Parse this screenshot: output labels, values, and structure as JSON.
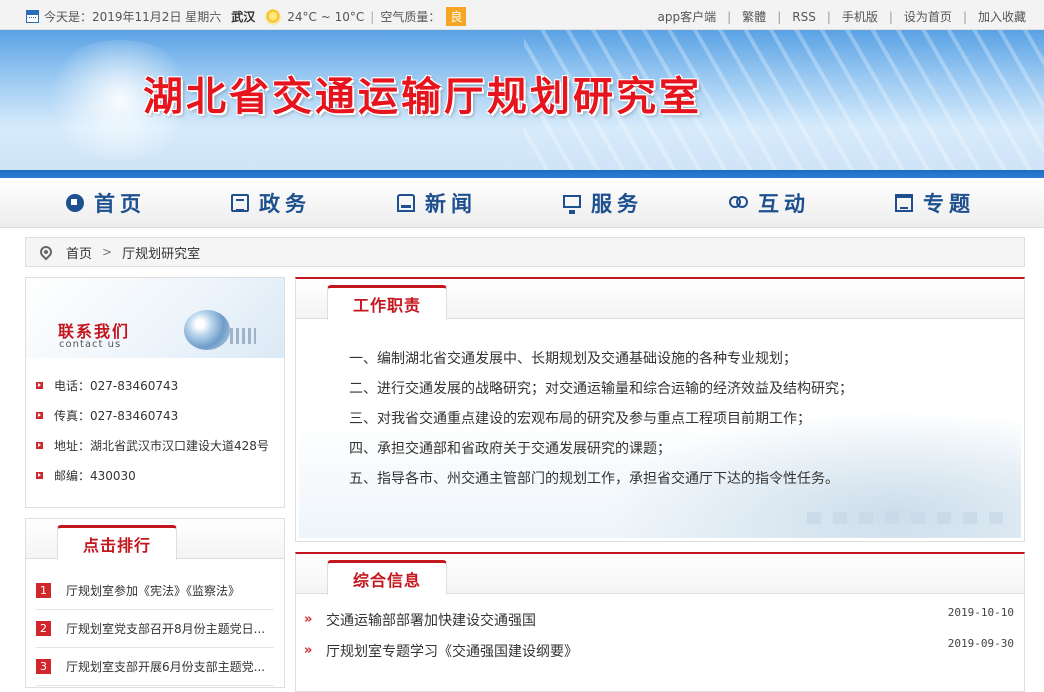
{
  "topbar": {
    "date_text": "今天是：2019年11月2日 星期六",
    "city": "武汉",
    "temperature": "24°C ~ 10°C",
    "air_quality_label": "空气质量：",
    "air_quality_value": "良",
    "air_quality_color": "#f5a623",
    "links": [
      "app客户端",
      "繁體",
      "RSS",
      "手机版",
      "设为首页",
      "加入收藏"
    ]
  },
  "banner": {
    "title": "湖北省交通运输厅规划研究室",
    "title_color": "#e6141c"
  },
  "nav": {
    "items": [
      {
        "label": "首页",
        "icon": "home-icon"
      },
      {
        "label": "政务",
        "icon": "book-icon"
      },
      {
        "label": "新闻",
        "icon": "news-icon"
      },
      {
        "label": "服务",
        "icon": "monitor-icon"
      },
      {
        "label": "互动",
        "icon": "people-icon"
      },
      {
        "label": "专题",
        "icon": "topic-icon"
      }
    ],
    "color": "#1e4f8f"
  },
  "breadcrumb": {
    "home": "首页",
    "current": "厅规划研究室"
  },
  "contact": {
    "title": "联系我们",
    "subtitle": "contact us",
    "rows": [
      "电话：027-83460743",
      "传真：027-83460743",
      "地址：湖北省武汉市汉口建设大道428号",
      "邮编：430030"
    ]
  },
  "rank": {
    "tab": "点击排行",
    "items": [
      {
        "num": "1",
        "title": "厅规划室参加《宪法》《监察法》"
      },
      {
        "num": "2",
        "title": "厅规划室党支部召开8月份主题党日..."
      },
      {
        "num": "3",
        "title": "厅规划室支部开展6月份支部主题党..."
      }
    ]
  },
  "duty": {
    "tab": "工作职责",
    "items": [
      "一、编制湖北省交通发展中、长期规划及交通基础设施的各种专业规划；",
      "二、进行交通发展的战略研究；对交通运输量和综合运输的经济效益及结构研究；",
      "三、对我省交通重点建设的宏观布局的研究及参与重点工程项目前期工作；",
      "四、承担交通部和省政府关于交通发展研究的课题；",
      "五、指导各市、州交通主管部门的规划工作，承担省交通厅下达的指令性任务。"
    ]
  },
  "info": {
    "tab": "综合信息",
    "items": [
      {
        "title": "交通运输部部署加快建设交通强国",
        "date": "2019-10-10"
      },
      {
        "title": "厅规划室专题学习《交通强国建设纲要》",
        "date": "2019-09-30"
      }
    ]
  },
  "accent_color": "#c3161e"
}
